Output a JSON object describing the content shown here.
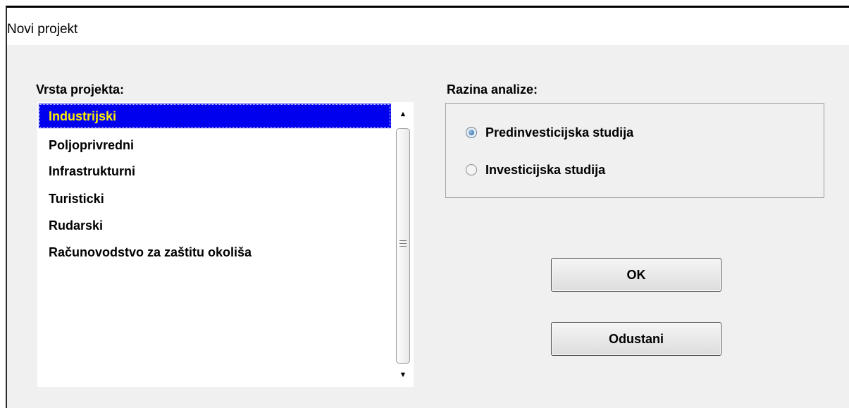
{
  "window": {
    "title": "Novi projekt"
  },
  "project_type": {
    "label": "Vrsta projekta:",
    "items": [
      "Industrijski",
      "Poljoprivredni",
      "Infrastrukturni",
      "Turisticki",
      "Rudarski",
      "Računovodstvo za zaštitu okoliša"
    ],
    "selected": "Industrijski"
  },
  "analysis_level": {
    "label": "Razina analize:",
    "options": [
      "Predinvesticijska studija",
      "Investicijska studija"
    ],
    "selected": "Predinvesticijska studija"
  },
  "buttons": {
    "ok": "OK",
    "cancel": "Odustani"
  },
  "icons": {
    "scroll_up": "triangle-up-icon",
    "scroll_down": "triangle-down-icon",
    "grip": "scrollbar-grip-icon"
  },
  "colors": {
    "selection_bg": "#0000ee",
    "selection_text": "#ffee00",
    "dialog_bg": "#f0f0f0"
  }
}
